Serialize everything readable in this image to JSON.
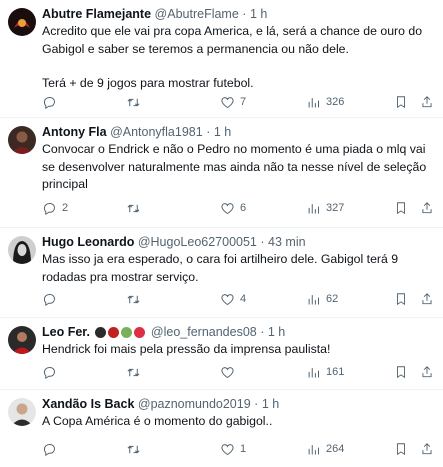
{
  "tweets": [
    {
      "name": "Abutre Flamejante",
      "handle": "@AbutreFlame",
      "time": "1 h",
      "text": "Acredito que ele vai pra copa America, e lá, será a chance de ouro do Gabigol e saber se teremos a permanencia ou não dele.",
      "text2": "Terá + de 9 jogos para mostrar futebol.",
      "replies": "",
      "retweets": "",
      "likes": "7",
      "views": "326"
    },
    {
      "name": "Antony Fla",
      "handle": "@Antonyfla1981",
      "time": "1 h",
      "text": "Convocar o Endrick e não o Pedro no momento é uma piada o mlq vai se desenvolver naturalmente mas ainda não ta nesse nível de seleção principal",
      "replies": "2",
      "retweets": "",
      "likes": "6",
      "views": "327"
    },
    {
      "name": "Hugo Leonardo",
      "handle": "@HugoLeo62700051",
      "time": "43 min",
      "text": "Mas isso ja era esperado, o cara foi artilheiro dele. Gabigol terá 9 rodadas pra mostrar serviço.",
      "replies": "",
      "retweets": "",
      "likes": "4",
      "views": "62"
    },
    {
      "name": "Leo Fer.",
      "handle": "@leo_fernandes08",
      "time": "1 h",
      "text": "Hendrick foi mais pela pressão da imprensa paulista!",
      "replies": "",
      "retweets": "",
      "likes": "",
      "views": "161"
    },
    {
      "name": "Xandão Is Back",
      "handle": "@paznomundo2019",
      "time": "1 h",
      "text": "A Copa América é o momento do gabigol..",
      "replies": "",
      "retweets": "",
      "likes": "1",
      "views": "264"
    }
  ],
  "separator": "·",
  "colors": {
    "text": "#0f1419",
    "muted": "#536471",
    "border": "#eff3f4"
  }
}
